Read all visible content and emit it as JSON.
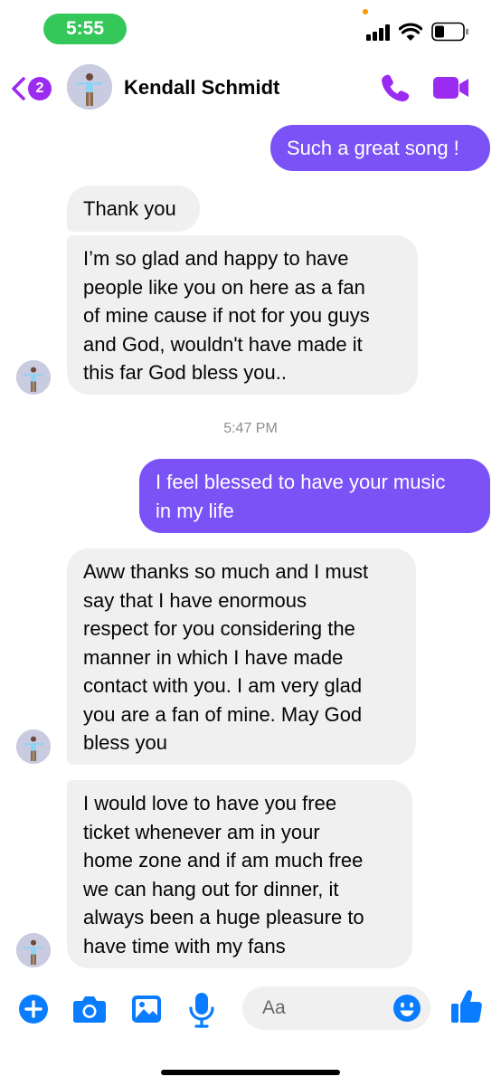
{
  "status_bar": {
    "time": "5:55"
  },
  "header": {
    "back_badge_count": "2",
    "contact_name": "Kendall Schmidt"
  },
  "messages": [
    {
      "direction": "outgoing",
      "text": "Such a great song !"
    },
    {
      "direction": "incoming",
      "text": "Thank you"
    },
    {
      "direction": "incoming",
      "text": "I’m so  glad and happy to have\npeople like you on here as a fan\nof mine cause if not for you guys\nand God, wouldn't have made it\nthis far God bless you.."
    },
    {
      "direction": "timestamp",
      "text": "5:47 PM"
    },
    {
      "direction": "outgoing",
      "text": "I feel blessed to have your music\nin my life"
    },
    {
      "direction": "incoming",
      "text": "Aww thanks so much and I must\nsay that I have enormous\nrespect for you considering the\nmanner in which I have made\ncontact with you. I am very glad\nyou are a fan of mine. May God\nbless you"
    },
    {
      "direction": "incoming",
      "text": "I would love to have you free\nticket whenever am in your\nhome zone and if am much free\nwe can hang out for dinner, it\nalways been a huge pleasure to\nhave time with my fans"
    }
  ],
  "composer": {
    "placeholder": "Aa"
  },
  "colors": {
    "accent": "#9c2bf2",
    "outgoing_bubble": "#7b52f6",
    "incoming_bubble": "#f0f0f0",
    "composer_icons": "#0a7cff",
    "status_pill": "#34c759"
  },
  "icons": {
    "back": "chevron-left-icon",
    "call": "phone-icon",
    "video": "video-camera-icon",
    "add": "plus-circle-icon",
    "camera": "camera-icon",
    "gallery": "image-icon",
    "voice": "microphone-icon",
    "emoji": "smiley-icon",
    "like": "thumbs-up-icon"
  }
}
